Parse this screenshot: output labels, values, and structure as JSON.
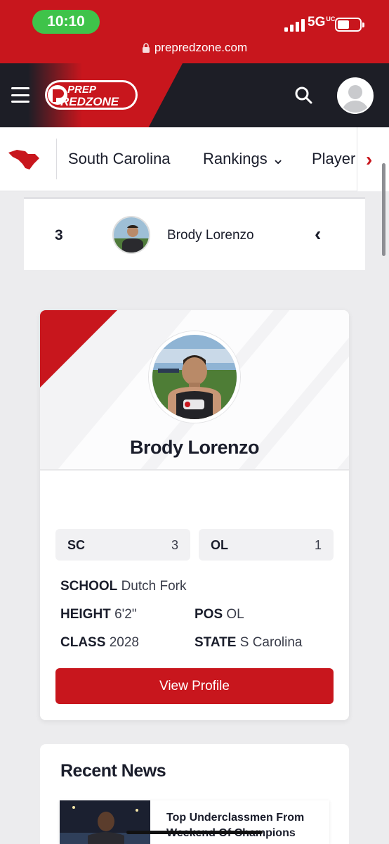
{
  "status_bar": {
    "time": "10:10",
    "network": "5G",
    "network_sup": "UC",
    "url": "prepredzone.com"
  },
  "header": {
    "logo_line1": "PREP",
    "logo_line2": "REDZONE",
    "menu_icon": "hamburger-icon",
    "search_icon": "search-icon",
    "avatar_icon": "user-avatar-icon"
  },
  "state_nav": {
    "state_icon": "south-carolina-map-icon",
    "items": [
      "South Carolina",
      "Rankings ⌄",
      "Player"
    ],
    "next_arrow": "›"
  },
  "rank_row": {
    "rank": "3",
    "name": "Brody Lorenzo",
    "chevron": "‹"
  },
  "player_card": {
    "name": "Brody Lorenzo",
    "stats": [
      {
        "label": "SC",
        "value": "3"
      },
      {
        "label": "OL",
        "value": "1"
      }
    ],
    "school_label": "SCHOOL",
    "school": "Dutch Fork",
    "height_label": "HEIGHT",
    "height": "6'2\"",
    "pos_label": "POS",
    "pos": "OL",
    "class_label": "CLASS",
    "class": "2028",
    "state_label": "STATE",
    "state": "S Carolina",
    "button": "View Profile"
  },
  "news": {
    "title": "Recent News",
    "items": [
      {
        "headline": "Top Underclassmen From Weekend Of Champions"
      }
    ]
  },
  "colors": {
    "brand_red": "#c8161d",
    "dark": "#1d1e26",
    "status_green": "#3fc34a"
  }
}
